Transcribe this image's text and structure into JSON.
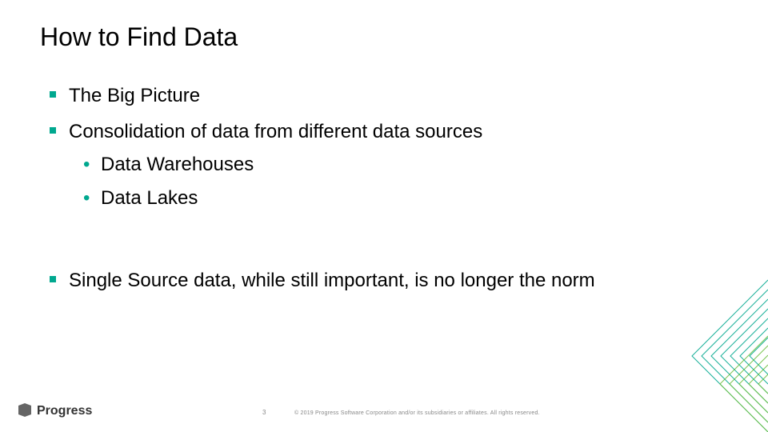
{
  "title": "How to Find Data",
  "bullets": {
    "b1": "The Big Picture",
    "b2": "Consolidation of data from different data sources",
    "b2a": "Data Warehouses",
    "b2b": "Data Lakes",
    "b3": "Single Source data, while still important, is no longer the norm"
  },
  "footer": {
    "logo_text": "Progress",
    "page_number": "3",
    "copyright": "© 2019 Progress Software Corporation and/or its subsidiaries or affiliates. All rights reserved."
  },
  "colors": {
    "accent": "#00a88f"
  }
}
